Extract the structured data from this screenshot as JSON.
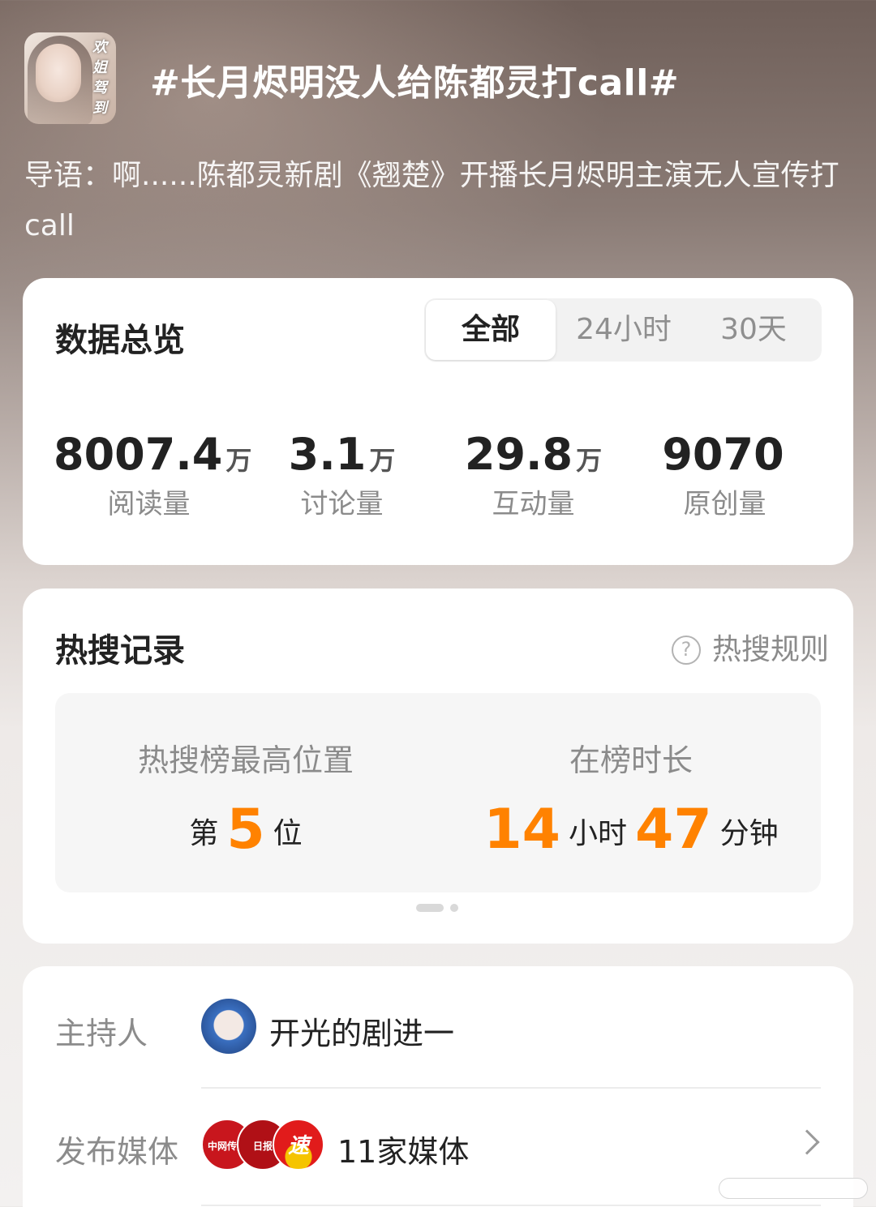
{
  "header": {
    "avatar_text": "欢姐驾到",
    "topic_title": "#长月烬明没人给陈都灵打call#"
  },
  "intro": "导语：啊......陈都灵新剧《翘楚》开播长月烬明主演无人宣传打call",
  "overview": {
    "title": "数据总览",
    "tabs": [
      "全部",
      "24小时",
      "30天"
    ],
    "active_tab": "全部",
    "stats": [
      {
        "value": "8007.4",
        "unit": "万",
        "label": "阅读量"
      },
      {
        "value": "3.1",
        "unit": "万",
        "label": "讨论量"
      },
      {
        "value": "29.8",
        "unit": "万",
        "label": "互动量"
      },
      {
        "value": "9070",
        "unit": "",
        "label": "原创量"
      }
    ]
  },
  "hot_search": {
    "title": "热搜记录",
    "rules_label": "热搜规则",
    "rules_icon": "?",
    "highest": {
      "caption": "热搜榜最高位置",
      "prefix": "第",
      "rank": "5",
      "suffix": "位"
    },
    "duration": {
      "caption": "在榜时长",
      "hours": "14",
      "hours_unit": "小时",
      "minutes": "47",
      "minutes_unit": "分钟"
    }
  },
  "info": {
    "host_label": "主持人",
    "host_name": "开光的剧进一",
    "media_label": "发布媒体",
    "media_count": "11家媒体",
    "media_logos": [
      "中网传播",
      "日报",
      "速"
    ]
  },
  "colors": {
    "accent": "#ff8200",
    "card": "#ffffff",
    "muted_text": "#8b8b8b"
  }
}
